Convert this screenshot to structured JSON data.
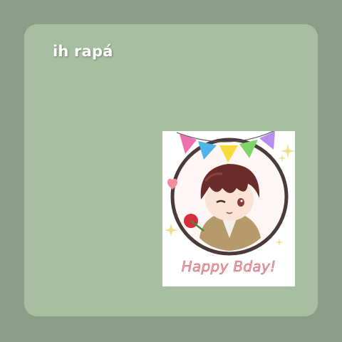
{
  "caption": {
    "text": "ih rapá"
  },
  "sticker": {
    "greeting": "Happy Bday!",
    "image_subject": "chibi-character-portrait",
    "bunting_colors": [
      "#f06fae",
      "#4fb4ea",
      "#f7dc3c",
      "#7fd46a",
      "#b68df0"
    ]
  },
  "colors": {
    "background": "#8c9e87",
    "card": "#a7bea1",
    "caption_text": "#ffffff",
    "greeting_text": "#f2a6ad"
  }
}
